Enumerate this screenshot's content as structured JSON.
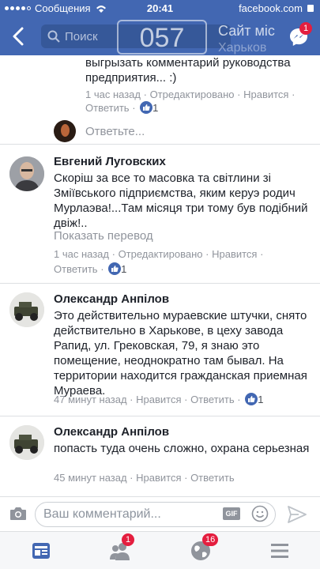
{
  "status_bar": {
    "carrier": "Сообщения",
    "time": "20:41",
    "site": "facebook.com"
  },
  "nav": {
    "search_placeholder": "Поиск",
    "watermark_number": "057",
    "watermark_text": "Сайт міс",
    "watermark_sub": "Харьков",
    "messenger_badge": "1"
  },
  "prev_comment": {
    "text": "выгрызать комментарий руководства предприятия... :)",
    "time": "1 час назад",
    "edited": "Отредактировано",
    "like": "Нравится",
    "reply": "Ответить",
    "likes": "1"
  },
  "reply_prompt": "Ответьте...",
  "comments": [
    {
      "author": "Евгений Луговских",
      "text": "Скоріш за все то масовка та світлини зі Зміївського підприємства, яким керуэ родич Мурлаэва!...Там місяця три тому був подібний двіж!..",
      "translate": "Показать перевод",
      "time": "1 час назад",
      "edited": "Отредактировано",
      "like": "Нравится",
      "reply": "Ответить",
      "likes": "1"
    },
    {
      "author": "Олександр Анпілов",
      "text": "Это действительно мураевские штучки, снято действительно в Харькове, в цеху завода Рапид, ул. Грековская, 79, я знаю это помещение, неоднократно там бывал. На территории находится гражданская приемная Мураева.",
      "time": "47 минут назад",
      "like": "Нравится",
      "reply": "Ответить",
      "likes": "1"
    },
    {
      "author": "Олександр Анпілов",
      "text": "попасть туда очень сложно, охрана серьезная",
      "time": "45 минут назад",
      "like": "Нравится",
      "reply": "Ответить"
    }
  ],
  "composer": {
    "placeholder": "Ваш комментарий...",
    "gif": "GIF"
  },
  "tabs": {
    "friends_badge": "1",
    "notifications_badge": "16"
  },
  "colors": {
    "brand": "#4267b2",
    "badge": "#e41e3f",
    "meta": "#90949c"
  }
}
